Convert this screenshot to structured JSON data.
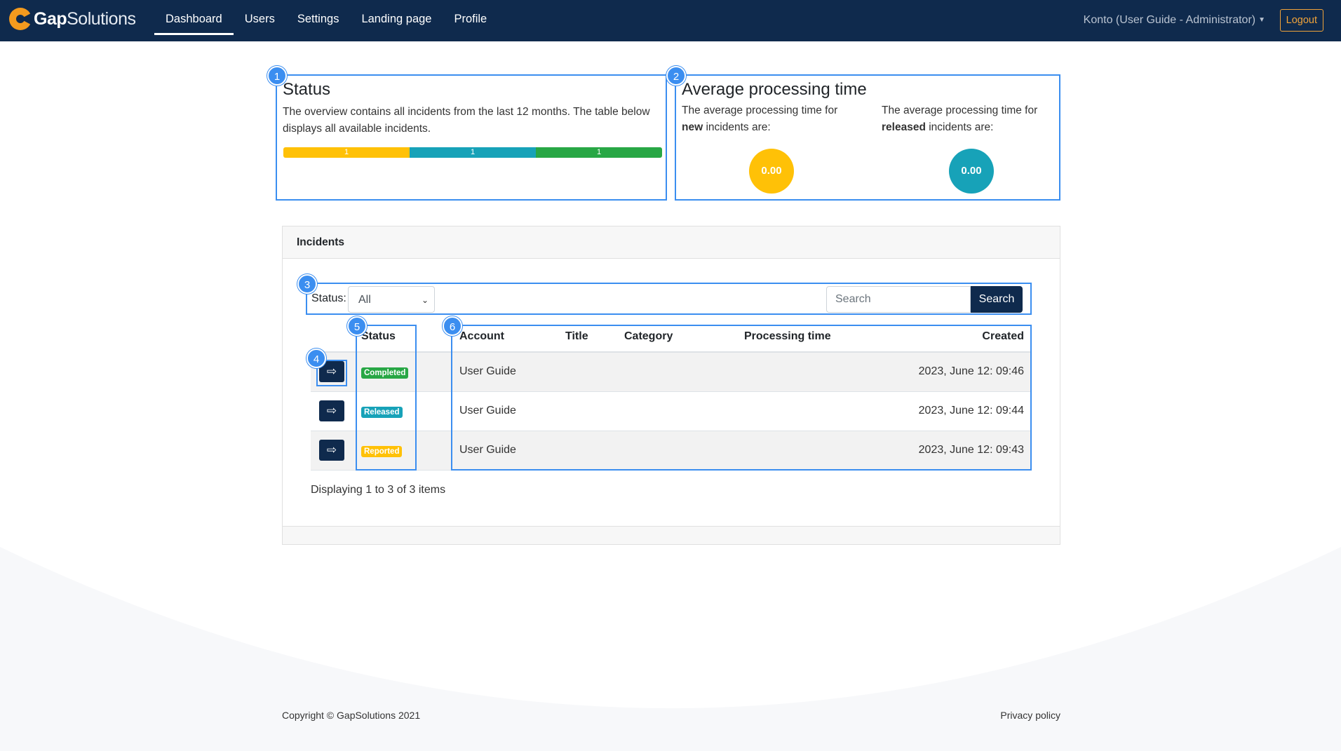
{
  "brand": {
    "bold": "Gap",
    "thin": "Solutions"
  },
  "nav": {
    "items": [
      {
        "label": "Dashboard"
      },
      {
        "label": "Users"
      },
      {
        "label": "Settings"
      },
      {
        "label": "Landing page"
      },
      {
        "label": "Profile"
      }
    ],
    "account": "Konto (User Guide - Administrator)",
    "logout": "Logout"
  },
  "markers": [
    "1",
    "2",
    "3",
    "4",
    "5",
    "6"
  ],
  "status_card": {
    "title": "Status",
    "text": "The overview contains all incidents from the last 12 months. The table below displays all available incidents.",
    "segments": [
      {
        "label": "1",
        "color": "#ffc107"
      },
      {
        "label": "1",
        "color": "#17a2b8"
      },
      {
        "label": "1",
        "color": "#28a745"
      }
    ]
  },
  "avg_card": {
    "title": "Average processing time",
    "new_text_a": "The average processing time for ",
    "new_bold": "new",
    "new_text_b": " incidents are:",
    "new_value": "0.00",
    "new_color": "#ffc107",
    "released_text_a": "The average processing time for ",
    "released_bold": "released",
    "released_text_b": " incidents are:",
    "released_value": "0.00",
    "released_color": "#17a2b8"
  },
  "incidents": {
    "title": "Incidents",
    "filter_label": "Status:",
    "filter_value": "All",
    "search_placeholder": "Search",
    "search_button": "Search",
    "columns": {
      "status": "Status",
      "account": "Account",
      "title": "Title",
      "category": "Category",
      "processing": "Processing time",
      "created": "Created"
    },
    "rows": [
      {
        "status": "Completed",
        "status_color": "#28a745",
        "account": "User Guide",
        "title": "",
        "category": "",
        "processing": "",
        "created": "2023, June 12: 09:46"
      },
      {
        "status": "Released",
        "status_color": "#17a2b8",
        "account": "User Guide",
        "title": "",
        "category": "",
        "processing": "",
        "created": "2023, June 12: 09:44"
      },
      {
        "status": "Reported",
        "status_color": "#ffc107",
        "account": "User Guide",
        "title": "",
        "category": "",
        "processing": "",
        "created": "2023, June 12: 09:43"
      }
    ],
    "pager": "Displaying 1 to 3 of 3 items",
    "go_icon": "⇨"
  },
  "footer": {
    "copyright": "Copyright © GapSolutions 2021",
    "privacy": "Privacy policy"
  }
}
